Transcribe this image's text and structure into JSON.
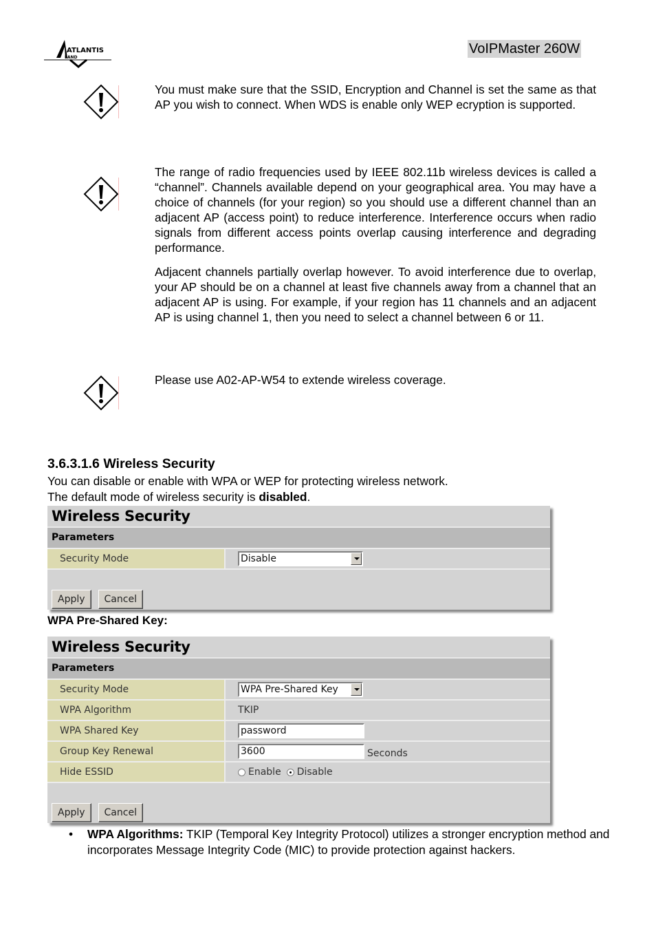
{
  "header": {
    "logo_text": "ATLANTIS",
    "logo_subtext": "LAND",
    "product": "VoIPMaster 260W"
  },
  "notes": [
    {
      "icon": "warning-icon",
      "paragraphs": [
        "You must make sure that the SSID, Encryption and Channel is set the same as that AP you wish to connect. When WDS is enable only WEP ecryption  is supported."
      ]
    },
    {
      "icon": "warning-icon",
      "paragraphs": [
        "The range of radio frequencies used by IEEE 802.11b wireless devices is called a “channel”. Channels available depend on your geographical area. You may have a choice of channels (for your region) so you should use a different channel than an adjacent AP (access point) to reduce interference. Interference occurs when radio signals from different access points overlap causing interference and degrading performance.",
        "Adjacent channels partially overlap however. To avoid interference due to overlap, your AP should be on a channel at least five channels away from a channel that an adjacent AP is using. For example, if your region has 11 channels and an adjacent AP is using channel 1, then you need to select a channel between 6 or 11."
      ]
    },
    {
      "icon": "warning-icon",
      "paragraphs": [
        "Please use A02-AP-W54 to extende wireless coverage."
      ]
    }
  ],
  "section": {
    "heading": "3.6.3.1.6 Wireless Security",
    "intro_line1": "You can disable or enable with WPA or WEP for protecting wireless network.",
    "intro_line2_prefix": "The default mode of wireless security is ",
    "intro_line2_bold": "disabled",
    "intro_line2_suffix": "."
  },
  "panel1": {
    "title": "Wireless Security",
    "section": "Parameters",
    "security_mode_label": "Security Mode",
    "security_mode_value": "Disable",
    "apply": "Apply",
    "cancel": "Cancel"
  },
  "wpa_heading": "WPA Pre-Shared Key:",
  "panel2": {
    "title": "Wireless Security",
    "section": "Parameters",
    "rows": {
      "security_mode_label": "Security Mode",
      "security_mode_value": "WPA Pre-Shared Key",
      "algorithm_label": "WPA Algorithm",
      "algorithm_value": "TKIP",
      "shared_key_label": "WPA Shared Key",
      "shared_key_value": "password",
      "renewal_label": "Group Key Renewal",
      "renewal_value": "3600",
      "renewal_unit": "Seconds",
      "hide_essid_label": "Hide ESSID",
      "hide_enable": "Enable",
      "hide_disable": "Disable",
      "hide_selected": "Disable"
    },
    "apply": "Apply",
    "cancel": "Cancel"
  },
  "bullets": [
    {
      "bold": "WPA Algorithms:",
      "text": " TKIP (Temporal Key Integrity Protocol) utilizes a stronger encryption method and incorporates Message Integrity Code (MIC) to provide protection against hackers."
    }
  ]
}
